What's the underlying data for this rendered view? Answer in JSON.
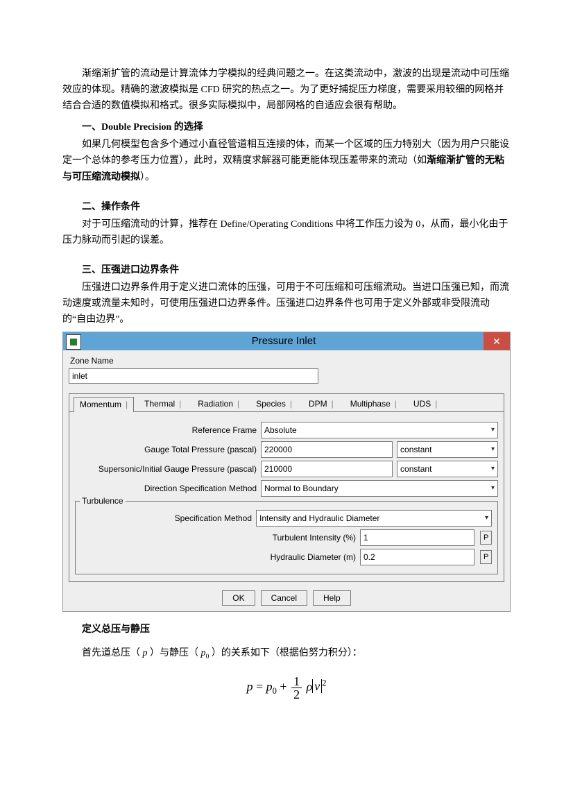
{
  "body": {
    "p1": "渐缩渐扩管的流动是计算流体力学模拟的经典问题之一。在这类流动中，激波的出现是流动中可压缩效应的体现。精确的激波模拟是 CFD 研究的热点之一。为了更好捕捉压力梯度，需要采用较细的网格并结合合适的数值模拟和格式。很多实际模拟中，局部网格的自适应会很有帮助。",
    "h1": "一、Double Precision 的选择",
    "p2a": "如果几何模型包含多个通过小直径管道相互连接的体，而某一个区域的压力特别大（因为用户只能设定一个总体的参考压力位置），此时，双精度求解器可能更能体现压差带来的流动（如",
    "p2b": "渐缩渐扩管的无粘与可压缩流动模拟",
    "p2c": "）。",
    "h2": "二、操作条件",
    "p3": "对于可压缩流动的计算，推荐在 Define/Operating Conditions 中将工作压力设为 0，从而，最小化由于压力脉动而引起的误差。",
    "h3": "三、压强进口边界条件",
    "p4": "压强进口边界条件用于定义进口流体的压强，可用于不可压缩和可压缩流动。当进口压强已知，而流动速度或流量未知时，可使用压强进口边界条件。压强进口边界条件也可用于定义外部或非受限流动的“自由边界”。",
    "sub_h": "定义总压与静压",
    "sub_p_a": "首先道总压（ ",
    "sub_p_p": "p",
    "sub_p_b": " ）与静压（ ",
    "sub_p_p0": "p",
    "sub_p_p0sub": "0",
    "sub_p_c": " ）的关系如下（根据伯努力积分）："
  },
  "dialog": {
    "title": "Pressure Inlet",
    "zone_label": "Zone Name",
    "zone_value": "inlet",
    "tabs": [
      "Momentum",
      "Thermal",
      "Radiation",
      "Species",
      "DPM",
      "Multiphase",
      "UDS"
    ],
    "ref_frame_label": "Reference Frame",
    "ref_frame_value": "Absolute",
    "gtp_label": "Gauge Total Pressure (pascal)",
    "gtp_value": "220000",
    "gtp_mode": "constant",
    "sigp_label": "Supersonic/Initial Gauge Pressure (pascal)",
    "sigp_value": "210000",
    "sigp_mode": "constant",
    "dsm_label": "Direction Specification Method",
    "dsm_value": "Normal to Boundary",
    "turb_group": "Turbulence",
    "spec_method_label": "Specification Method",
    "spec_method_value": "Intensity and Hydraulic Diameter",
    "ti_label": "Turbulent Intensity (%)",
    "ti_value": "1",
    "hd_label": "Hydraulic Diameter (m)",
    "hd_value": "0.2",
    "p_button": "P",
    "buttons": {
      "ok": "OK",
      "cancel": "Cancel",
      "help": "Help"
    },
    "close_glyph": "✕"
  },
  "chart_data": {
    "type": "table",
    "title": "Pressure Inlet boundary condition settings",
    "rows": [
      {
        "field": "Zone Name",
        "value": "inlet"
      },
      {
        "field": "Reference Frame",
        "value": "Absolute"
      },
      {
        "field": "Gauge Total Pressure (pascal)",
        "value": 220000,
        "mode": "constant"
      },
      {
        "field": "Supersonic/Initial Gauge Pressure (pascal)",
        "value": 210000,
        "mode": "constant"
      },
      {
        "field": "Direction Specification Method",
        "value": "Normal to Boundary"
      },
      {
        "field": "Turbulence Specification Method",
        "value": "Intensity and Hydraulic Diameter"
      },
      {
        "field": "Turbulent Intensity (%)",
        "value": 1
      },
      {
        "field": "Hydraulic Diameter (m)",
        "value": 0.2
      }
    ]
  }
}
